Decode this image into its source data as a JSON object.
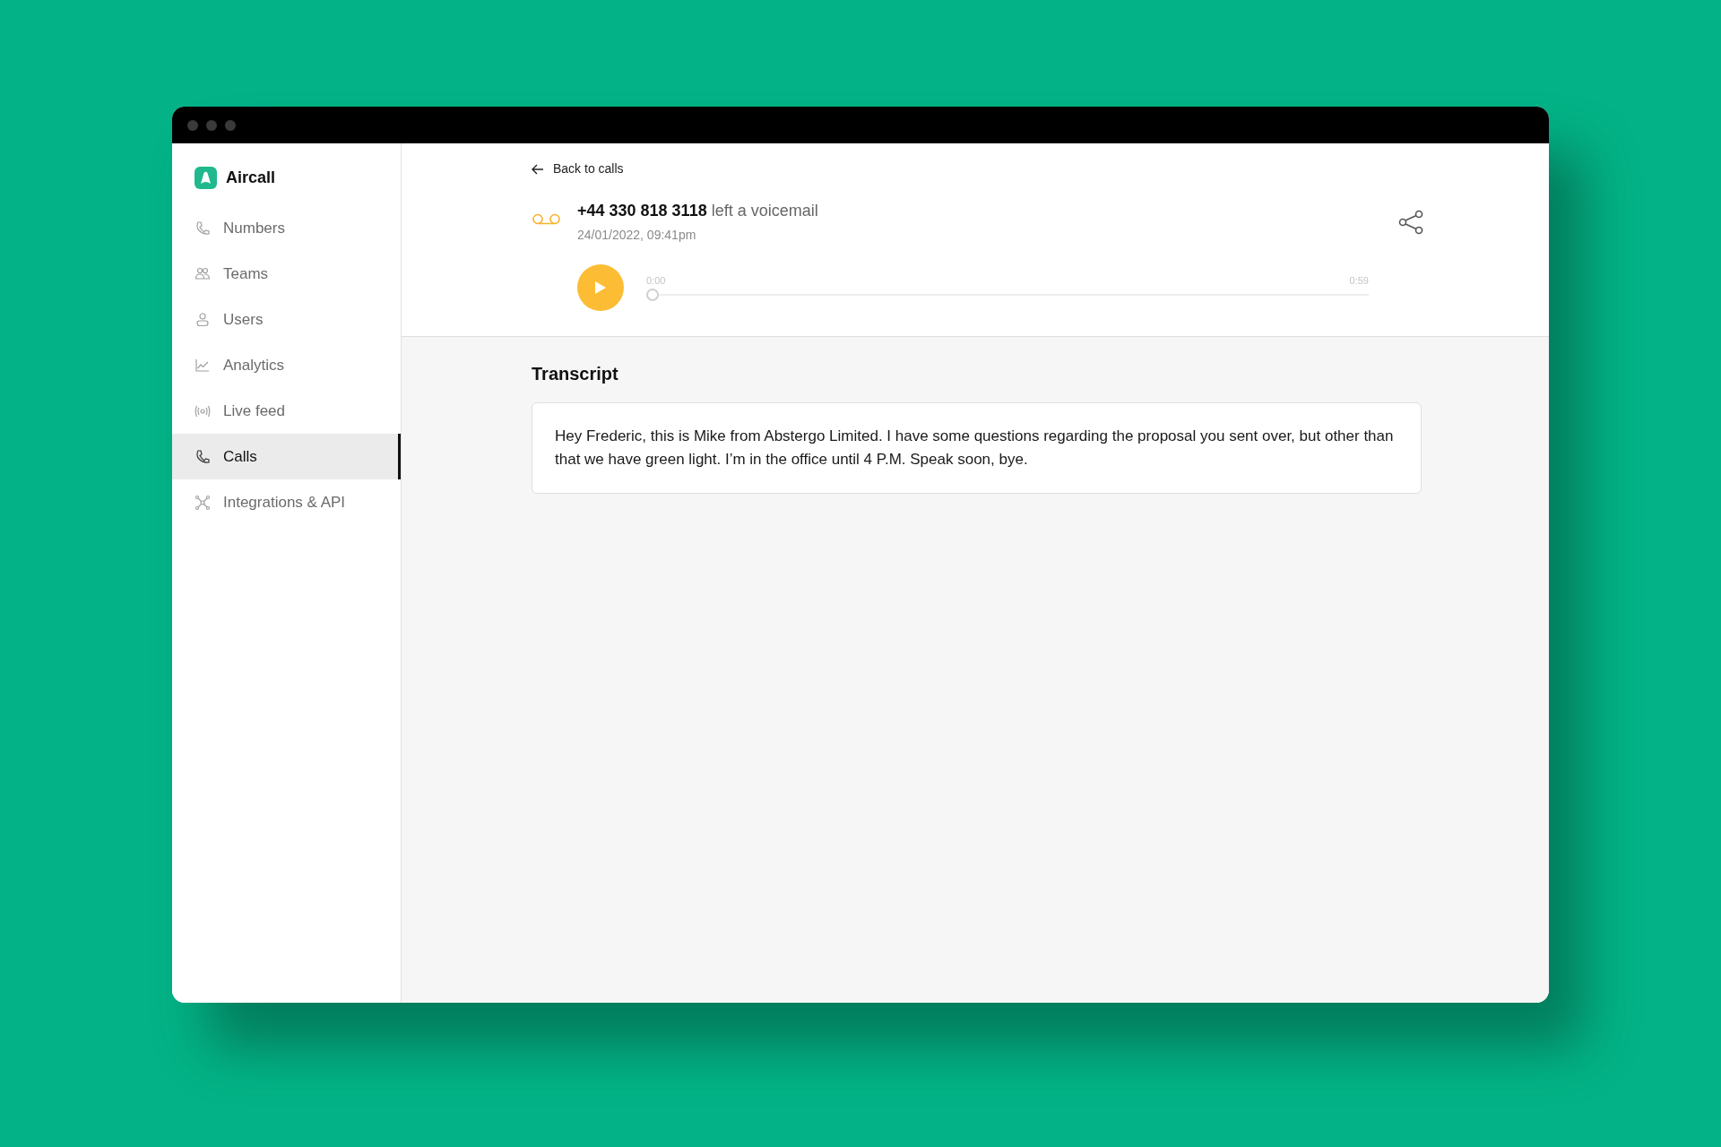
{
  "app": {
    "name": "Aircall"
  },
  "sidebar": {
    "items": [
      {
        "label": "Numbers",
        "selected": false
      },
      {
        "label": "Teams",
        "selected": false
      },
      {
        "label": "Users",
        "selected": false
      },
      {
        "label": "Analytics",
        "selected": false
      },
      {
        "label": "Live feed",
        "selected": false
      },
      {
        "label": "Calls",
        "selected": true
      },
      {
        "label": "Integrations & API",
        "selected": false
      }
    ]
  },
  "header": {
    "back_link": "Back to calls",
    "caller": "+44 330 818 3118",
    "caller_action": "left a voicemail",
    "timestamp": "24/01/2022, 09:41pm"
  },
  "player": {
    "elapsed": "0:00",
    "duration": "0:59",
    "level": 0
  },
  "transcript": {
    "title": "Transcript",
    "text": "Hey Frederic, this is Mike from Abstergo Limited. I have some questions regarding the proposal you sent over, but other than that we have green light. I’m in the office until 4 P.M. Speak soon, bye."
  }
}
